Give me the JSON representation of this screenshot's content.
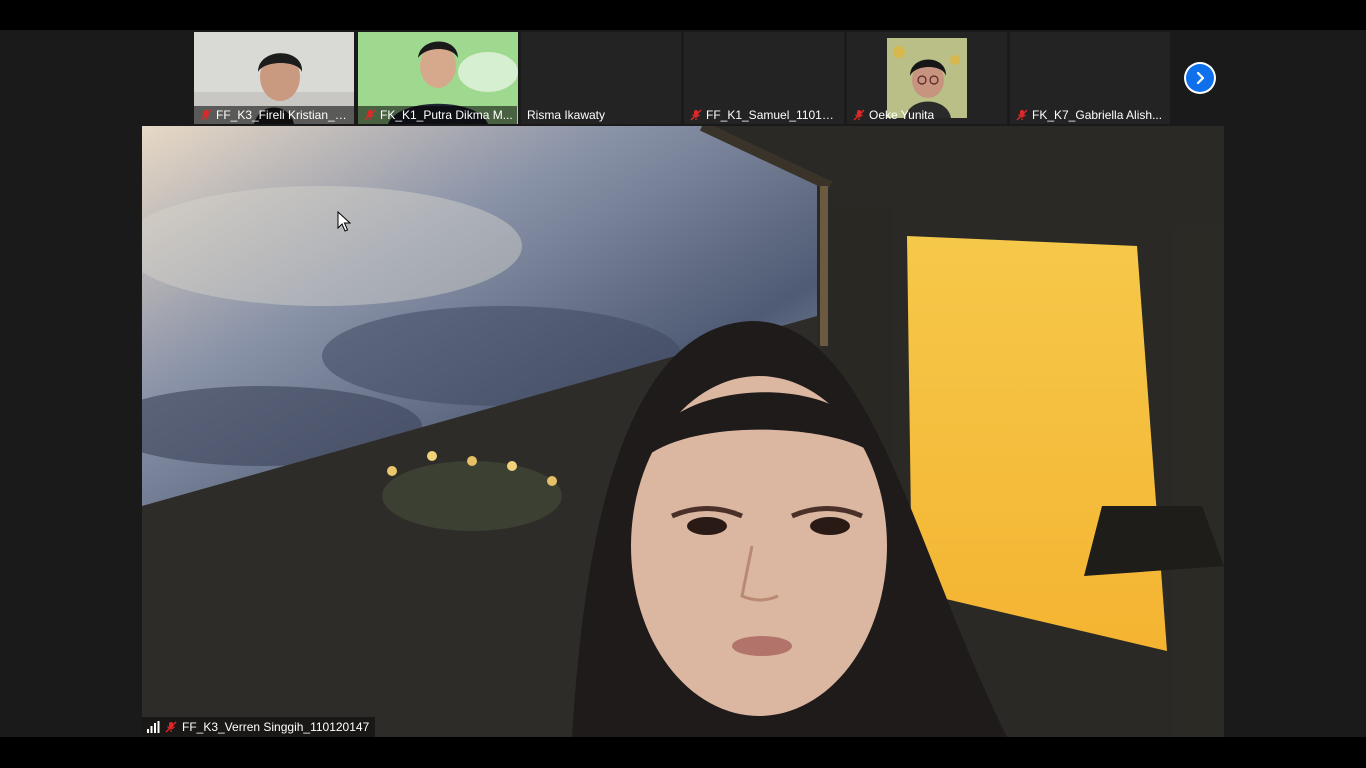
{
  "participants_strip": [
    {
      "name": "FF_K3_Fireli Kristian_1...",
      "muted": true,
      "video": "on"
    },
    {
      "name": "FK_K1_Putra Dikma M...",
      "muted": true,
      "video": "on"
    },
    {
      "name": "Risma Ikawaty",
      "muted": false,
      "video": "off"
    },
    {
      "name": "FF_K1_Samuel_110120...",
      "muted": true,
      "video": "off"
    },
    {
      "name": "Oeke Yunita",
      "muted": true,
      "video": "on"
    },
    {
      "name": "FK_K7_Gabriella Alish...",
      "muted": true,
      "video": "off"
    }
  ],
  "active_speaker": {
    "name": "FF_K3_Verren Singgih_110120147",
    "muted": true
  },
  "controls": {
    "next_page_icon": "chevron-right-icon",
    "signal_icon": "signal-bars-icon",
    "mute_icon": "mic-off-icon"
  },
  "colors": {
    "accent": "#0e71eb",
    "mute_red": "#e02828",
    "background": "#1a1a1a"
  }
}
